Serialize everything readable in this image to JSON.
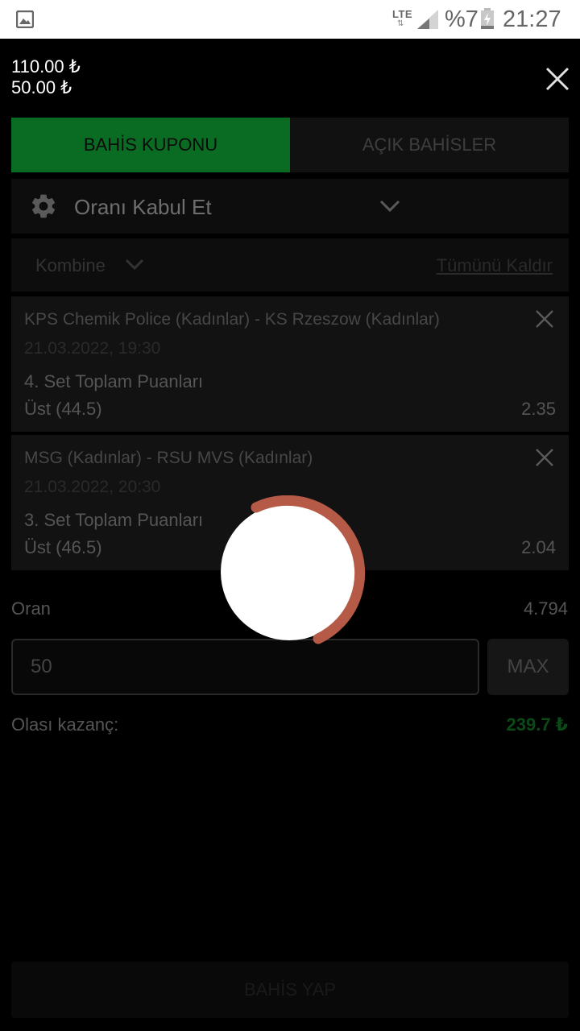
{
  "status_bar": {
    "network": "LTE",
    "network_arrows": "⇅",
    "battery_percent": "%7",
    "time": "21:27",
    "icons": [
      "gallery-icon",
      "signal-icon",
      "battery-charging-icon"
    ]
  },
  "header": {
    "balance_primary": "110.00 ₺",
    "balance_secondary": "50.00 ₺",
    "close_icon": "close-icon"
  },
  "tabs": [
    {
      "label": "BAHİS KUPONU",
      "active": true
    },
    {
      "label": "AÇIK BAHİSLER",
      "active": false
    }
  ],
  "accept_odds": {
    "label": "Oranı Kabul Et",
    "icon": "gear-icon"
  },
  "bet_type": {
    "label": "Kombine",
    "remove_all": "Tümünü Kaldır"
  },
  "bets": [
    {
      "match": "KPS Chemik Police (Kadınlar) - KS Rzeszow (Kadınlar)",
      "date": "21.03.2022, 19:30",
      "market": "4. Set Toplam Puanları",
      "selection": "Üst (44.5)",
      "odd": "2.35"
    },
    {
      "match": "MSG (Kadınlar) - RSU MVS (Kadınlar)",
      "date": "21.03.2022, 20:30",
      "market": "3. Set Toplam Puanları",
      "selection": "Üst (46.5)",
      "odd": "2.04"
    }
  ],
  "summary": {
    "odds_label": "Oran",
    "odds_value": "4.794",
    "stake_value": "50",
    "max_label": "MAX",
    "win_label": "Olası kazanç:",
    "win_value": "239.7 ₺"
  },
  "place_bet_label": "BAHİS YAP",
  "colors": {
    "accent_green": "#0a6b22",
    "loader_ring": "#b55a47"
  }
}
